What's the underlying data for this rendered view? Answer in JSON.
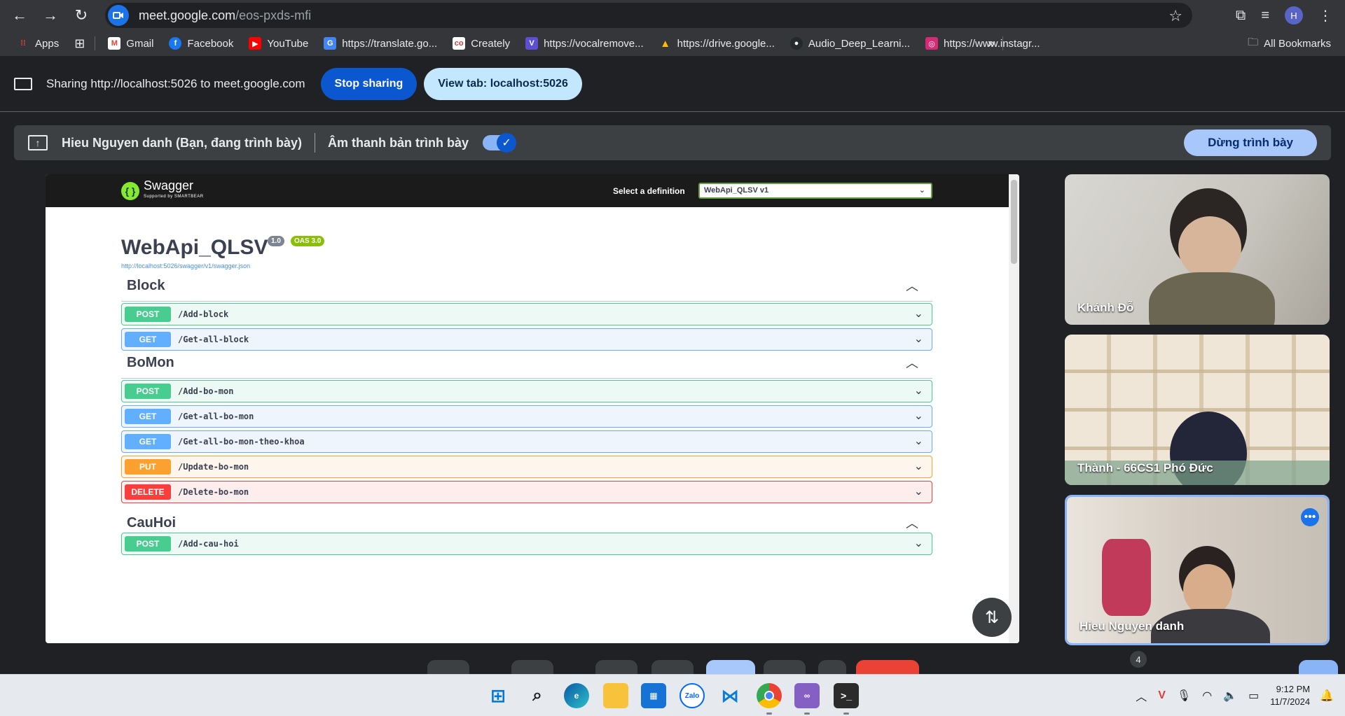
{
  "browser": {
    "url_host": "meet.google.com",
    "url_path": "/eos-pxds-mfi",
    "profile_initial": "H"
  },
  "bookmarks": [
    {
      "label": "Apps",
      "icon": "apps-grid-icon",
      "color": "#ea4335"
    },
    {
      "label": "Gmail",
      "icon": "gmail-icon",
      "color": "#ea4335"
    },
    {
      "label": "Facebook",
      "icon": "facebook-icon",
      "color": "#1877f2"
    },
    {
      "label": "YouTube",
      "icon": "youtube-icon",
      "color": "#ff0000"
    },
    {
      "label": "https://translate.go...",
      "icon": "translate-icon",
      "color": "#4285f4"
    },
    {
      "label": "Creately",
      "icon": "creately-icon",
      "color": "#e53935"
    },
    {
      "label": "https://vocalremove...",
      "icon": "vocalremover-icon",
      "color": "#5c4fd6"
    },
    {
      "label": "https://drive.google...",
      "icon": "drive-icon",
      "color": "#fbbc04"
    },
    {
      "label": "Audio_Deep_Learni...",
      "icon": "github-icon",
      "color": "#24292e"
    },
    {
      "label": "https://www.instagr...",
      "icon": "instagram-icon",
      "color": "#d62976"
    }
  ],
  "all_bookmarks_label": "All Bookmarks",
  "sharing_bar": {
    "text": "Sharing http://localhost:5026 to meet.google.com",
    "stop_label": "Stop sharing",
    "view_tab_label": "View tab: localhost:5026"
  },
  "present_bar": {
    "presenter_text": "Hieu Nguyen danh (Bạn, đang trình bày)",
    "audio_text": "Âm thanh bản trình bày",
    "audio_enabled": true,
    "stop_present_label": "Dừng trình bày"
  },
  "swagger": {
    "logo_text": "Swagger",
    "logo_sub": "Supported by SMARTBEAR",
    "select_label": "Select a definition",
    "selected_definition": "WebApi_QLSV v1",
    "api_title": "WebApi_QLSV",
    "version_badge": "1.0",
    "oas_badge": "OAS 3.0",
    "spec_link": "http://localhost:5026/swagger/v1/swagger.json",
    "tags": [
      {
        "name": "Block",
        "operations": [
          {
            "method": "POST",
            "path": "/Add-block"
          },
          {
            "method": "GET",
            "path": "/Get-all-block"
          }
        ]
      },
      {
        "name": "BoMon",
        "operations": [
          {
            "method": "POST",
            "path": "/Add-bo-mon"
          },
          {
            "method": "GET",
            "path": "/Get-all-bo-mon"
          },
          {
            "method": "GET",
            "path": "/Get-all-bo-mon-theo-khoa"
          },
          {
            "method": "PUT",
            "path": "/Update-bo-mon"
          },
          {
            "method": "DELETE",
            "path": "/Delete-bo-mon"
          }
        ]
      },
      {
        "name": "CauHoi",
        "operations": [
          {
            "method": "POST",
            "path": "/Add-cau-hoi"
          }
        ]
      }
    ]
  },
  "participants": [
    {
      "name": "Khánh Đỗ"
    },
    {
      "name": "Thành - 66CS1 Phó Đức"
    },
    {
      "name": "Hieu Nguyen danh"
    }
  ],
  "participant_count": "4",
  "taskbar": {
    "apps": [
      "start-icon",
      "search-icon",
      "edge-icon",
      "file-explorer-icon",
      "store-icon",
      "zalo-icon",
      "vscode-icon",
      "chrome-icon",
      "visual-studio-icon",
      "terminal-icon"
    ],
    "time": "9:12 PM",
    "date": "11/7/2024"
  }
}
